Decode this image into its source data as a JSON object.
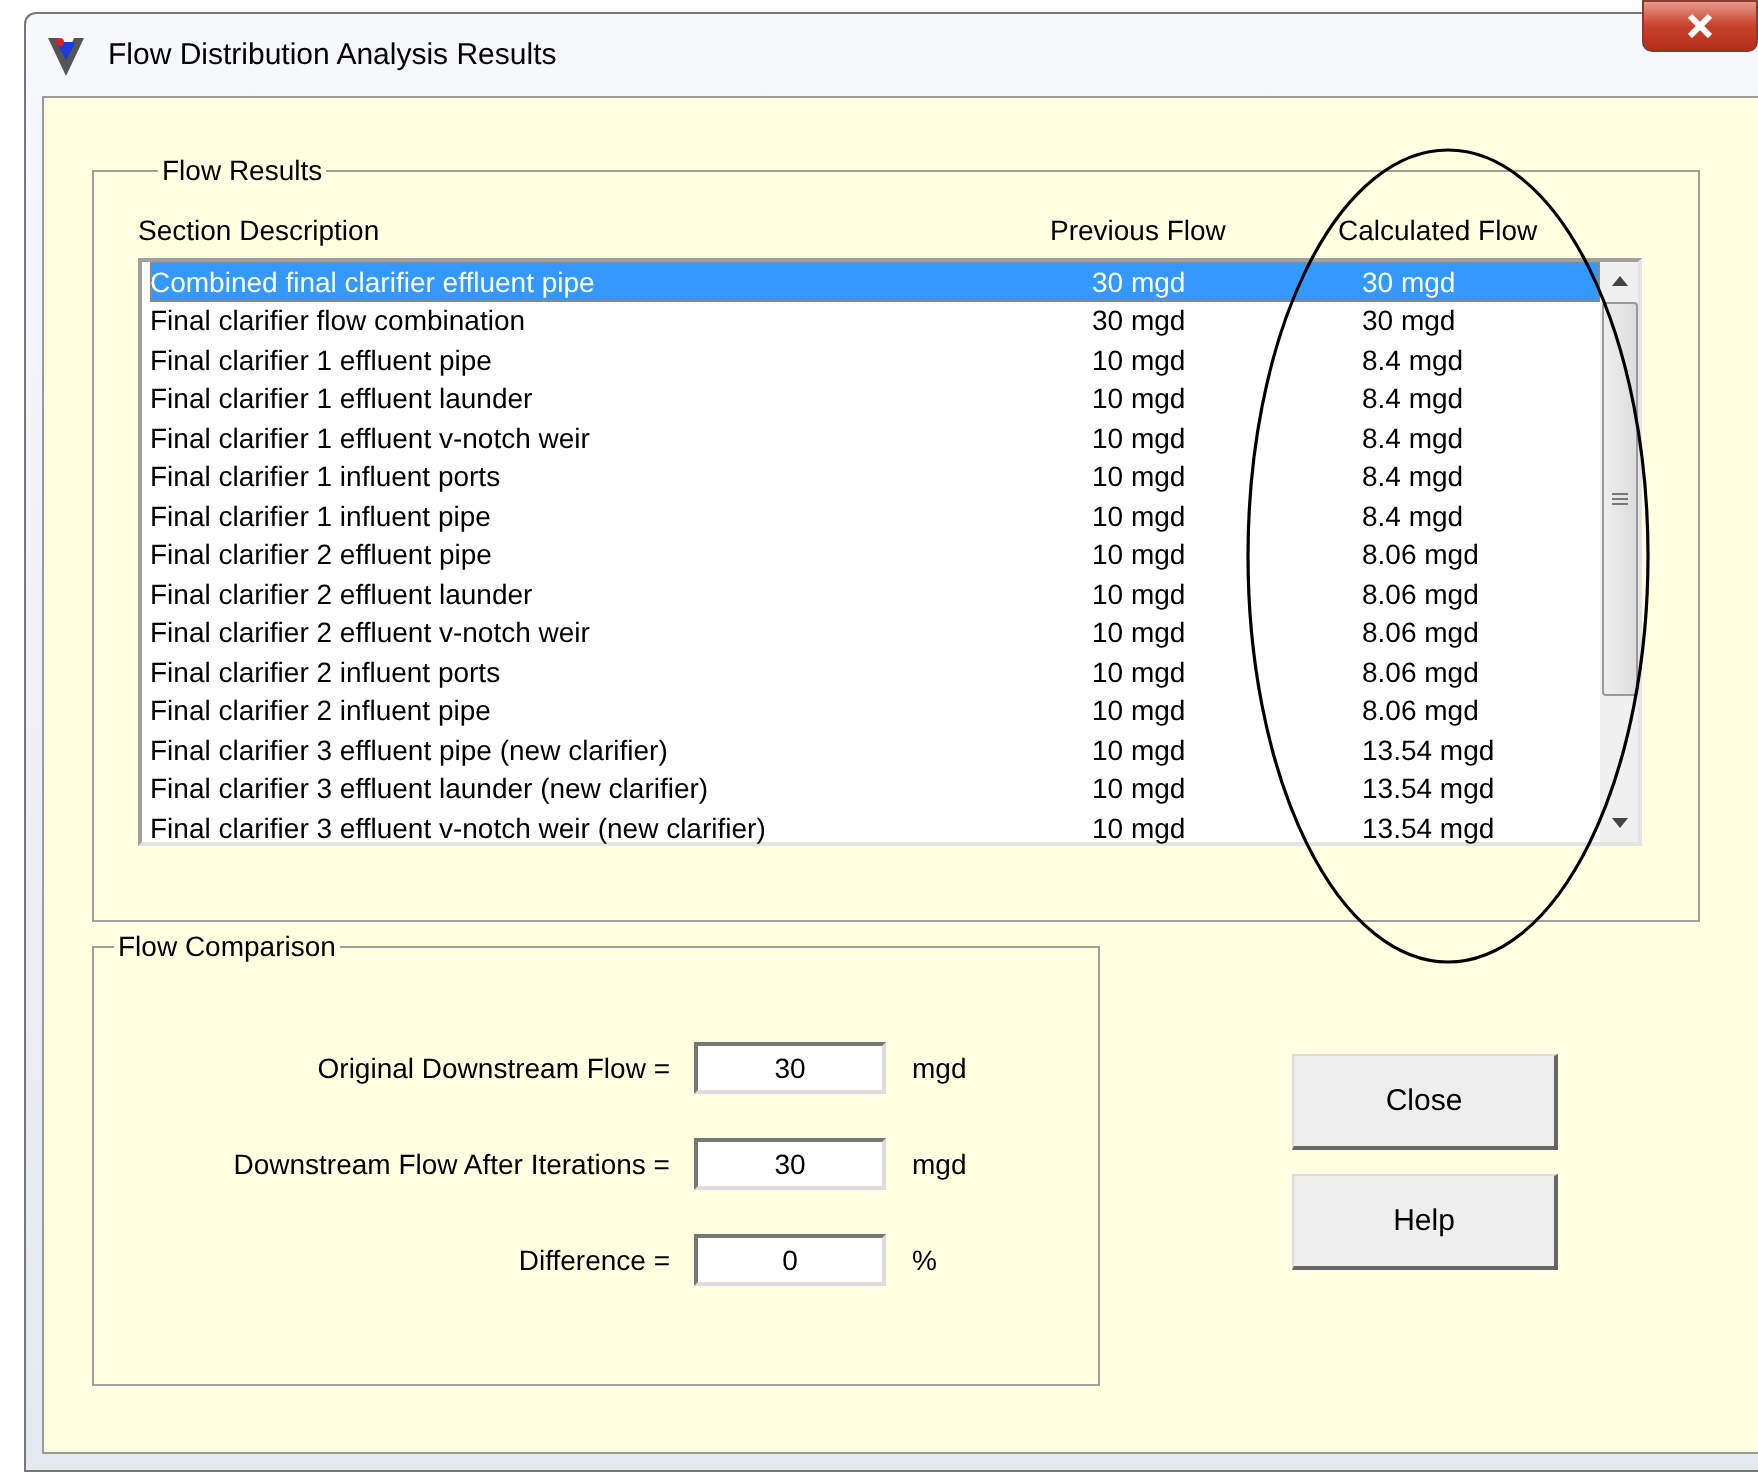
{
  "window": {
    "title": "Flow Distribution Analysis Results"
  },
  "flow_results": {
    "title": "Flow Results",
    "columns": [
      "Section Description",
      "Previous Flow",
      "Calculated Flow"
    ],
    "rows": [
      {
        "description": "Combined final clarifier effluent pipe",
        "previous": "30 mgd",
        "calculated": "30 mgd",
        "selected": true
      },
      {
        "description": "Final clarifier flow combination",
        "previous": "30 mgd",
        "calculated": "30 mgd",
        "selected": false
      },
      {
        "description": "Final clarifier 1 effluent pipe",
        "previous": "10 mgd",
        "calculated": "8.4 mgd",
        "selected": false
      },
      {
        "description": "Final clarifier 1 effluent launder",
        "previous": "10 mgd",
        "calculated": "8.4 mgd",
        "selected": false
      },
      {
        "description": "Final clarifier 1 effluent v-notch weir",
        "previous": "10 mgd",
        "calculated": "8.4 mgd",
        "selected": false
      },
      {
        "description": "Final clarifier 1 influent ports",
        "previous": "10 mgd",
        "calculated": "8.4 mgd",
        "selected": false
      },
      {
        "description": "Final clarifier 1 influent pipe",
        "previous": "10 mgd",
        "calculated": "8.4 mgd",
        "selected": false
      },
      {
        "description": "Final clarifier 2 effluent pipe",
        "previous": "10 mgd",
        "calculated": "8.06 mgd",
        "selected": false
      },
      {
        "description": "Final clarifier 2 effluent launder",
        "previous": "10 mgd",
        "calculated": "8.06 mgd",
        "selected": false
      },
      {
        "description": "Final clarifier 2 effluent v-notch weir",
        "previous": "10 mgd",
        "calculated": "8.06 mgd",
        "selected": false
      },
      {
        "description": "Final clarifier 2 influent ports",
        "previous": "10 mgd",
        "calculated": "8.06 mgd",
        "selected": false
      },
      {
        "description": "Final clarifier 2 influent pipe",
        "previous": "10 mgd",
        "calculated": "8.06 mgd",
        "selected": false
      },
      {
        "description": "Final clarifier 3 effluent pipe (new clarifier)",
        "previous": "10 mgd",
        "calculated": "13.54 mgd",
        "selected": false
      },
      {
        "description": "Final clarifier 3 effluent launder (new clarifier)",
        "previous": "10 mgd",
        "calculated": "13.54 mgd",
        "selected": false
      },
      {
        "description": "Final clarifier 3 effluent v-notch weir (new clarifier)",
        "previous": "10 mgd",
        "calculated": "13.54 mgd",
        "selected": false
      }
    ]
  },
  "flow_comparison": {
    "title": "Flow Comparison",
    "fields": [
      {
        "label": "Original Downstream Flow =",
        "value": "30",
        "unit": "mgd"
      },
      {
        "label": "Downstream Flow After Iterations =",
        "value": "30",
        "unit": "mgd"
      },
      {
        "label": "Difference =",
        "value": "0",
        "unit": "%"
      }
    ]
  },
  "buttons": [
    "Close",
    "Help"
  ]
}
